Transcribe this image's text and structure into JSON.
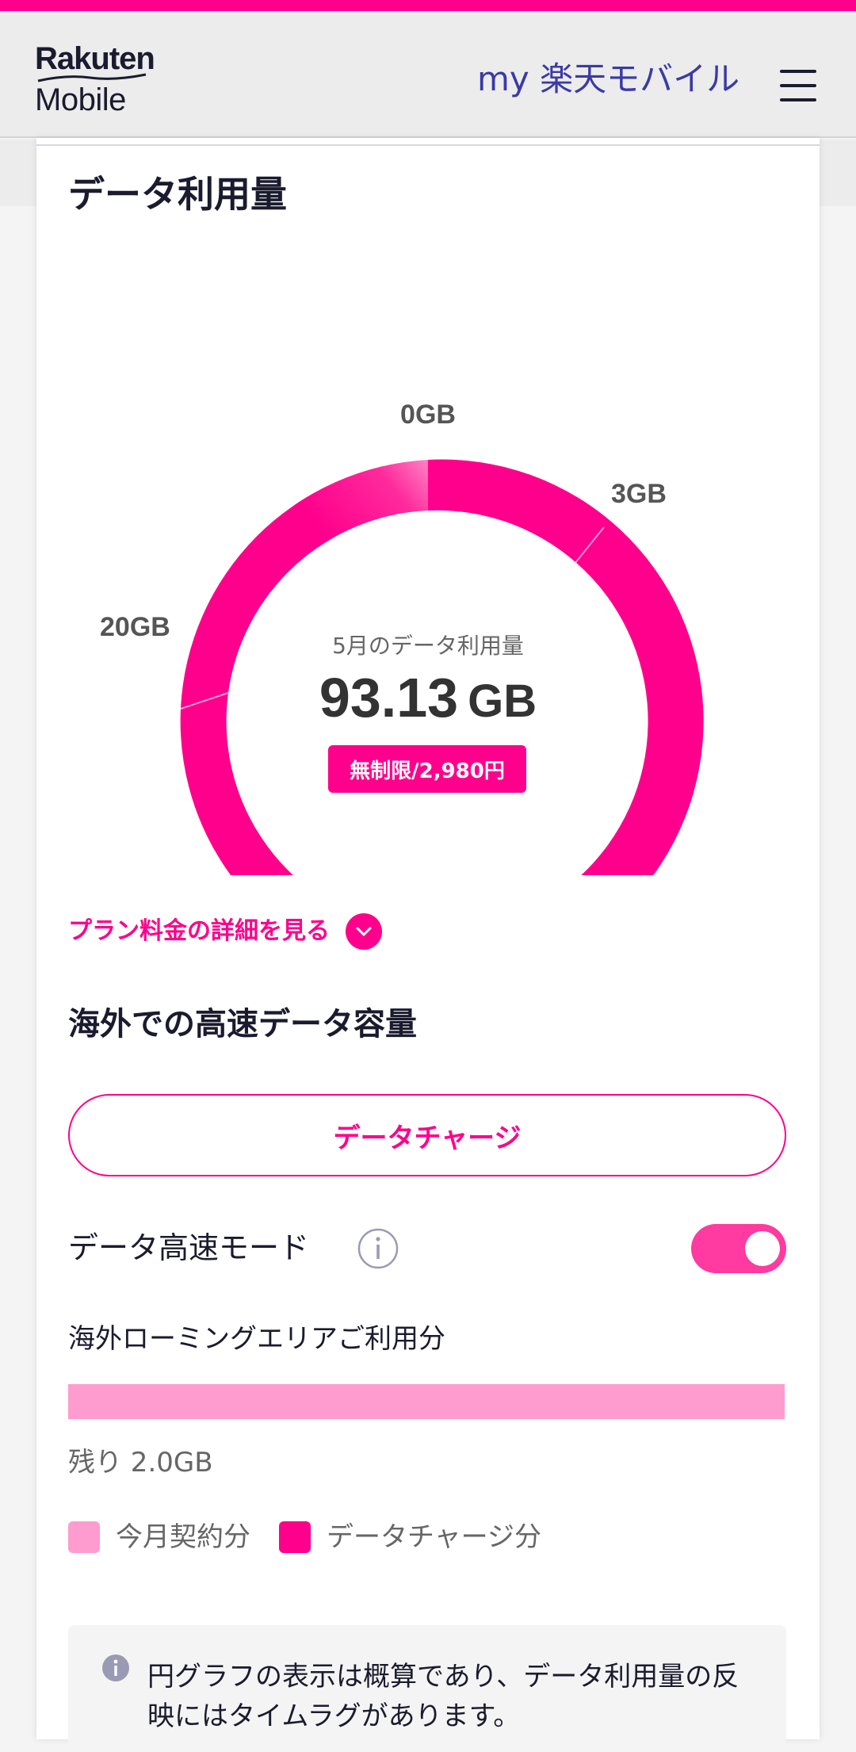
{
  "header": {
    "logo_line1": "Rakuten",
    "logo_line2": "Mobile",
    "title": "my 楽天モバイル"
  },
  "colors": {
    "brand": "#ff008c",
    "brand_light": "#ff9ccf",
    "title_blue": "#3a3aa8"
  },
  "usage": {
    "section_title": "データ利用量",
    "center_label": "5月のデータ利用量",
    "amount_number": "93.13",
    "amount_unit": "GB",
    "plan_badge": "無制限/2,980円",
    "tick_labels": [
      "0GB",
      "3GB",
      "20GB"
    ]
  },
  "chart_data": {
    "type": "pie",
    "tick_labels": [
      "0GB",
      "3GB",
      "20GB"
    ],
    "tiers_gb": [
      0,
      3,
      20
    ],
    "value_gb": 93.13,
    "title": "データ利用量"
  },
  "plan_link": {
    "label": "プラン料金の詳細を見る",
    "icon": "chevron-down-icon"
  },
  "overseas": {
    "title": "海外での高速データ容量",
    "charge_button": "データチャージ",
    "mode_label": "データ高速モード",
    "mode_enabled": true,
    "roaming_label": "海外ローミングエリアご利用分",
    "bar_fill_fraction": 1.0,
    "remaining": "残り 2.0GB",
    "legend": [
      {
        "label": "今月契約分",
        "color": "#ff9ccf"
      },
      {
        "label": "データチャージ分",
        "color": "#ff008c"
      }
    ]
  },
  "note": {
    "text": "円グラフの表示は概算であり、データ利用量の反映にはタイムラグがあります。"
  }
}
